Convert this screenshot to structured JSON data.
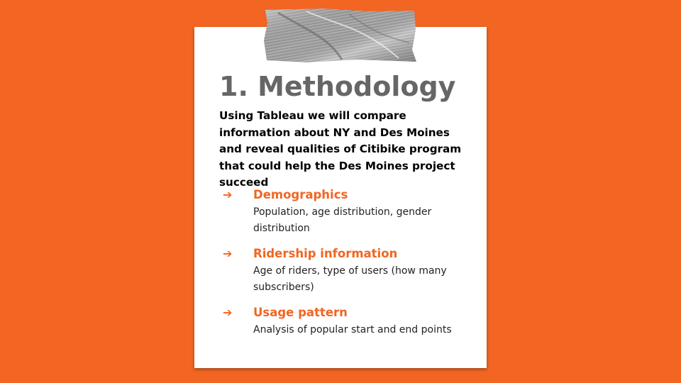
{
  "slide": {
    "title": "1. Methodology",
    "intro": "Using Tableau we will compare information about NY and Des Moines and reveal qualities of Citibike program that could help the Des Moines project succeed",
    "items": [
      {
        "arrow": "➔",
        "heading": "Demographics",
        "description": "Population, age distribution, gender distribution"
      },
      {
        "arrow": "➔",
        "heading": "Ridership information",
        "description": "Age of riders, type of users (how many subscribers)"
      },
      {
        "arrow": "➔",
        "heading": "Usage pattern",
        "description": "Analysis of popular start and end points"
      }
    ]
  },
  "colors": {
    "background": "#f26522",
    "card": "#ffffff",
    "title": "#666666",
    "accent": "#f26522"
  }
}
